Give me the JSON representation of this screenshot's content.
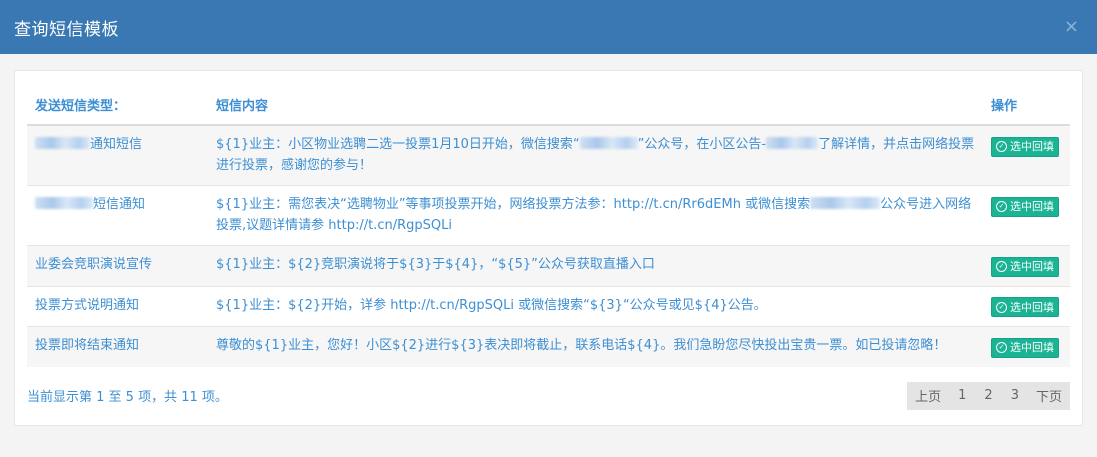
{
  "modal": {
    "title": "查询短信模板",
    "close_glyph": "×"
  },
  "table": {
    "headers": {
      "type": "发送短信类型：",
      "content": "短信内容",
      "action": "操作"
    },
    "action_label": "选中回填",
    "rows": [
      {
        "type_prefix": "",
        "type_suffix": "通知短信",
        "content_parts": [
          "${1}业主：小区物业选聘二选一投票1月10日开始，微信搜索“",
          "”公众号，在小区公告-",
          "了解详情，并点击网络投票进行投票，感谢您的参与！"
        ]
      },
      {
        "type_prefix": "",
        "type_suffix": "短信通知",
        "content_parts": [
          "${1}业主：需您表决“选聘物业”等事项投票开始，网络投票方法参：http://t.cn/Rr6dEMh 或微信搜索",
          "公众号进入网络投票,议题详情请参 http://t.cn/RgpSQLi"
        ]
      },
      {
        "type": "业委会竞职演说宣传",
        "content": "${1}业主：${2}竞职演说将于${3}于${4}，“${5}”公众号获取直播入口"
      },
      {
        "type": "投票方式说明通知",
        "content": "${1}业主：${2}开始，详参 http://t.cn/RgpSQLi 或微信搜索“${3}“公众号或见${4}公告。"
      },
      {
        "type": "投票即将结束通知",
        "content": "尊敬的${1}业主，您好！小区${2}进行${3}表决即将截止，联系电话${4}。我们急盼您尽快投出宝贵一票。如已投请忽略！"
      }
    ]
  },
  "footer": {
    "info": "当前显示第 1 至 5 项，共 11 项。",
    "pager": {
      "prev": "上页",
      "pages": [
        "1",
        "2",
        "3"
      ],
      "next": "下页"
    }
  }
}
